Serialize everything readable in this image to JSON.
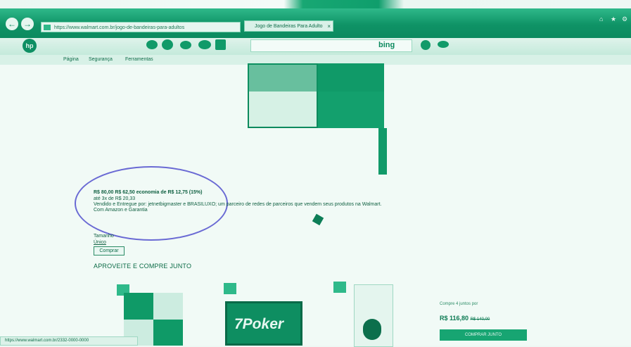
{
  "browser": {
    "address_url": "https://www.walmart.com.br/jogo-de-bandeiras-para-adultos",
    "tab_title": "Jogo de Bandeiras Para Adulto",
    "search_engine_label": "bing",
    "menu": [
      "Página",
      "Segurança",
      "Ferramentas"
    ],
    "status_url": "https://www.walmart.com.br/2332-0000-0000"
  },
  "product": {
    "price_line": "R$ 80,00 R$ 62,50 economia de R$ 12,75 (15%)",
    "installments": "até 3x de R$ 20,33",
    "seller_line": "Vendido e Entregue por: jetnetbigmaster e BRASILUXO; um parceiro de redes de parceiros que vendem seus produtos na Walmart.",
    "delivery_line": "Com Amazon e Garantia",
    "size_label": "Tamanho",
    "size_value": "Único",
    "buy_button": "Comprar",
    "section_title": "APROVEITE E COMPRE JUNTO"
  },
  "bundle": {
    "label": "Compre 4 juntos por",
    "price": "R$ 116,80",
    "old_price": "R$ 140,00",
    "button": "COMPRAR JUNTO"
  },
  "product2_text": "7Poker",
  "colors": {
    "titlebar": "#0f9366",
    "annotation_circle": "#6a6ad4",
    "accent": "#17a572"
  }
}
